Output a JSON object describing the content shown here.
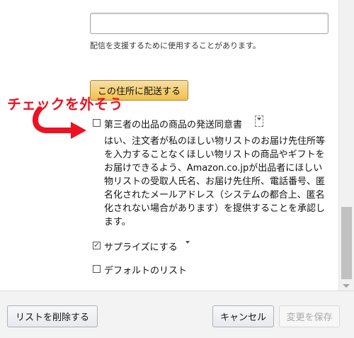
{
  "form": {
    "hint": "配信を支援するために使用することがあります。",
    "ship_button": "この住所に配送する",
    "consent_label": "第三者の出品の商品の発送同意書",
    "consent_description": "はい、注文者が私のほしい物リストのお届け先住所等を入力することなくほしい物リストの商品やギフトをお届けできるよう、Amazon.co.jpが出品者にほしい物リストの受取人氏名、お届け先住所、電話番号、匿名化されたメールアドレス（システムの都合上、匿名化されない場合があります）を提供することを承認します。",
    "surprise_label": "サプライズにする",
    "surprise_check": "✓",
    "default_label": "デフォルトのリスト"
  },
  "annotation": {
    "text": "チェックを外そう",
    "color": "#ee1122"
  },
  "footer": {
    "delete_button": "リストを削除する",
    "cancel_button": "キャンセル",
    "save_button": "変更を保存"
  },
  "colors": {
    "ship_button": "#f0c14b",
    "annotation": "#ee1122",
    "footer": "#f3f3f3"
  }
}
